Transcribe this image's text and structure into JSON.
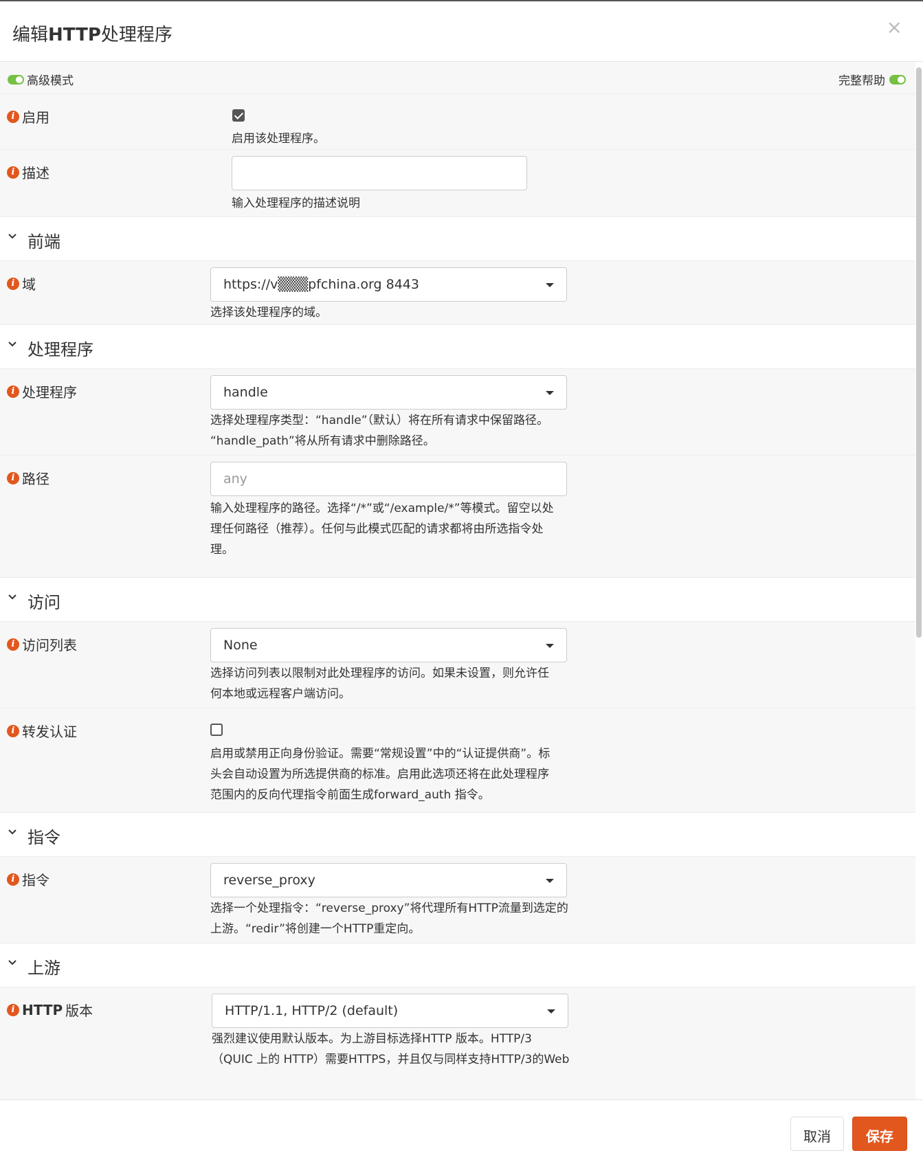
{
  "dialog": {
    "title_prefix": "编辑",
    "title_bold": "HTTP",
    "title_suffix": "处理程序",
    "close": "×"
  },
  "topbar": {
    "advanced_mode": "高级模式",
    "full_help": "完整帮助"
  },
  "fields": {
    "enable": {
      "label": "启用",
      "checked": true,
      "help": "启用该处理程序。"
    },
    "description": {
      "label": "描述",
      "value": "",
      "help": "输入处理程序的描述说明"
    },
    "domain": {
      "label": "域",
      "value": "https://v▒▒▒pfchina.org 8443",
      "help": "选择该处理程序的域。"
    },
    "handler": {
      "label": "处理程序",
      "value": "handle",
      "help_line1": "选择处理程序类型：“handle”（默认）将在所有请求中保留路径。",
      "help_line2": "“handle_path”将从所有请求中删除路径。"
    },
    "path": {
      "label": "路径",
      "placeholder": "any",
      "help_line1": "输入处理程序的路径。选择“/*”或“/example/*”等模式。留空以处",
      "help_line2": "理任何路径（推荐）。任何与此模式匹配的请求都将由所选指令处",
      "help_line3": "理。"
    },
    "access_list": {
      "label": "访问列表",
      "value": "None",
      "help_line1": "选择访问列表以限制对此处理程序的访问。如果未设置，则允许任",
      "help_line2": "何本地或远程客户端访问。"
    },
    "forward_auth": {
      "label": "转发认证",
      "checked": false,
      "help_line1": "启用或禁用正向身份验证。需要“常规设置”中的“认证提供商”。标",
      "help_line2": "头会自动设置为所选提供商的标准。启用此选项还将在此处理程序",
      "help_line3": "范围内的反向代理指令前面生成forward_auth 指令。"
    },
    "directive": {
      "label": "指令",
      "value": "reverse_proxy",
      "help_line1": "选择一个处理指令：“reverse_proxy”将代理所有HTTP流量到选定的",
      "help_line2": "上游。“redir”将创建一个HTTP重定向。"
    },
    "http_version": {
      "label_bold": "HTTP",
      "label_rest": "版本",
      "value": "HTTP/1.1, HTTP/2 (default)",
      "help_line1": "强烈建议使用默认版本。为上游目标选择HTTP 版本。HTTP/3",
      "help_line2": "（QUIC 上的 HTTP）需要HTTPS，并且仅与同样支持HTTP/3的Web"
    }
  },
  "sections": {
    "frontend": "前端",
    "handler": "处理程序",
    "access": "访问",
    "directive": "指令",
    "upstream": "上游"
  },
  "footer": {
    "cancel": "取消",
    "save": "保存"
  },
  "colors": {
    "accent": "#e2571e",
    "toggle_on": "#76c043"
  }
}
